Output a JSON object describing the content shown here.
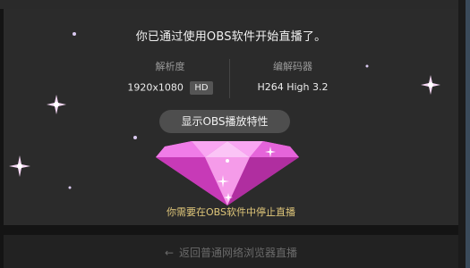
{
  "headline": "你已通过使用OBS软件开始直播了。",
  "info": {
    "resolution_label": "解析度",
    "resolution_value": "1920x1080",
    "hd_badge": "HD",
    "codec_label": "编解码器",
    "codec_value": "H264 High 3.2"
  },
  "show_button_label": "显示OBS播放特性",
  "stop_hint": "你需要在OBS软件中停止直播",
  "back_link": "返回普通网络浏览器直播",
  "icons": {
    "back": "arrow-left-icon",
    "decoration": "diamond-icon",
    "sparkle": "sparkle-icon"
  },
  "colors": {
    "accent_gold": "#e0c77a",
    "diamond_pink": "#e85ad8"
  }
}
